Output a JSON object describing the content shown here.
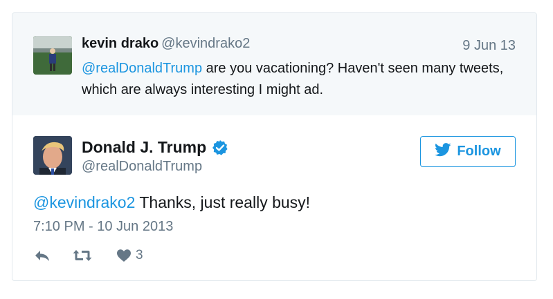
{
  "parent_tweet": {
    "name": "kevin drako",
    "handle": "@kevindrako2",
    "date": "9 Jun 13",
    "mention": "@realDonaldTrump",
    "text": " are you vacationing? Haven't seen many tweets, which are always interesting I might ad."
  },
  "main_tweet": {
    "name": "Donald J. Trump",
    "handle": "@realDonaldTrump",
    "follow_label": "Follow",
    "mention": "@kevindrako2",
    "text": " Thanks, just really busy!",
    "timestamp": "7:10 PM - 10 Jun 2013",
    "like_count": "3"
  },
  "colors": {
    "link": "#1b95e0",
    "muted": "#657786",
    "parent_bg": "#f5f8fa",
    "border": "#e1e8ed"
  },
  "icons": [
    "verified-badge-icon",
    "twitter-bird-icon",
    "reply-icon",
    "retweet-icon",
    "heart-icon"
  ]
}
